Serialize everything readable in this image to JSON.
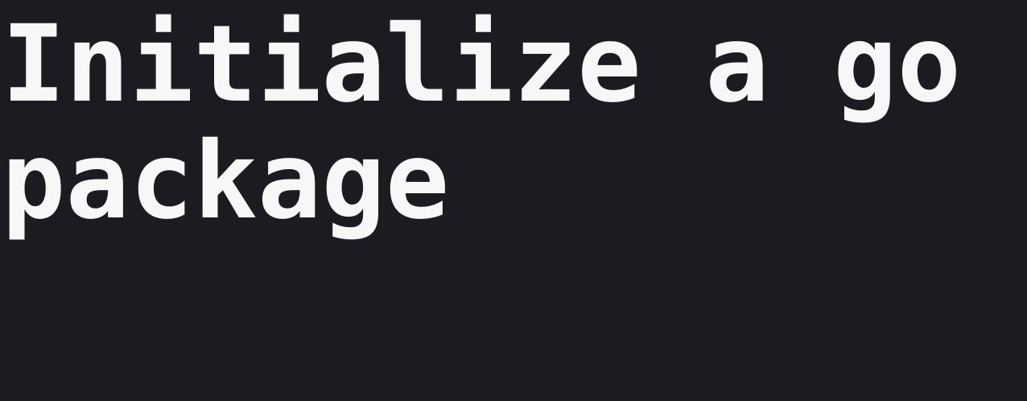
{
  "page": {
    "title": "Initialize a go package",
    "background_color": "#1b1c21",
    "text_color": "#f7f7f7"
  }
}
